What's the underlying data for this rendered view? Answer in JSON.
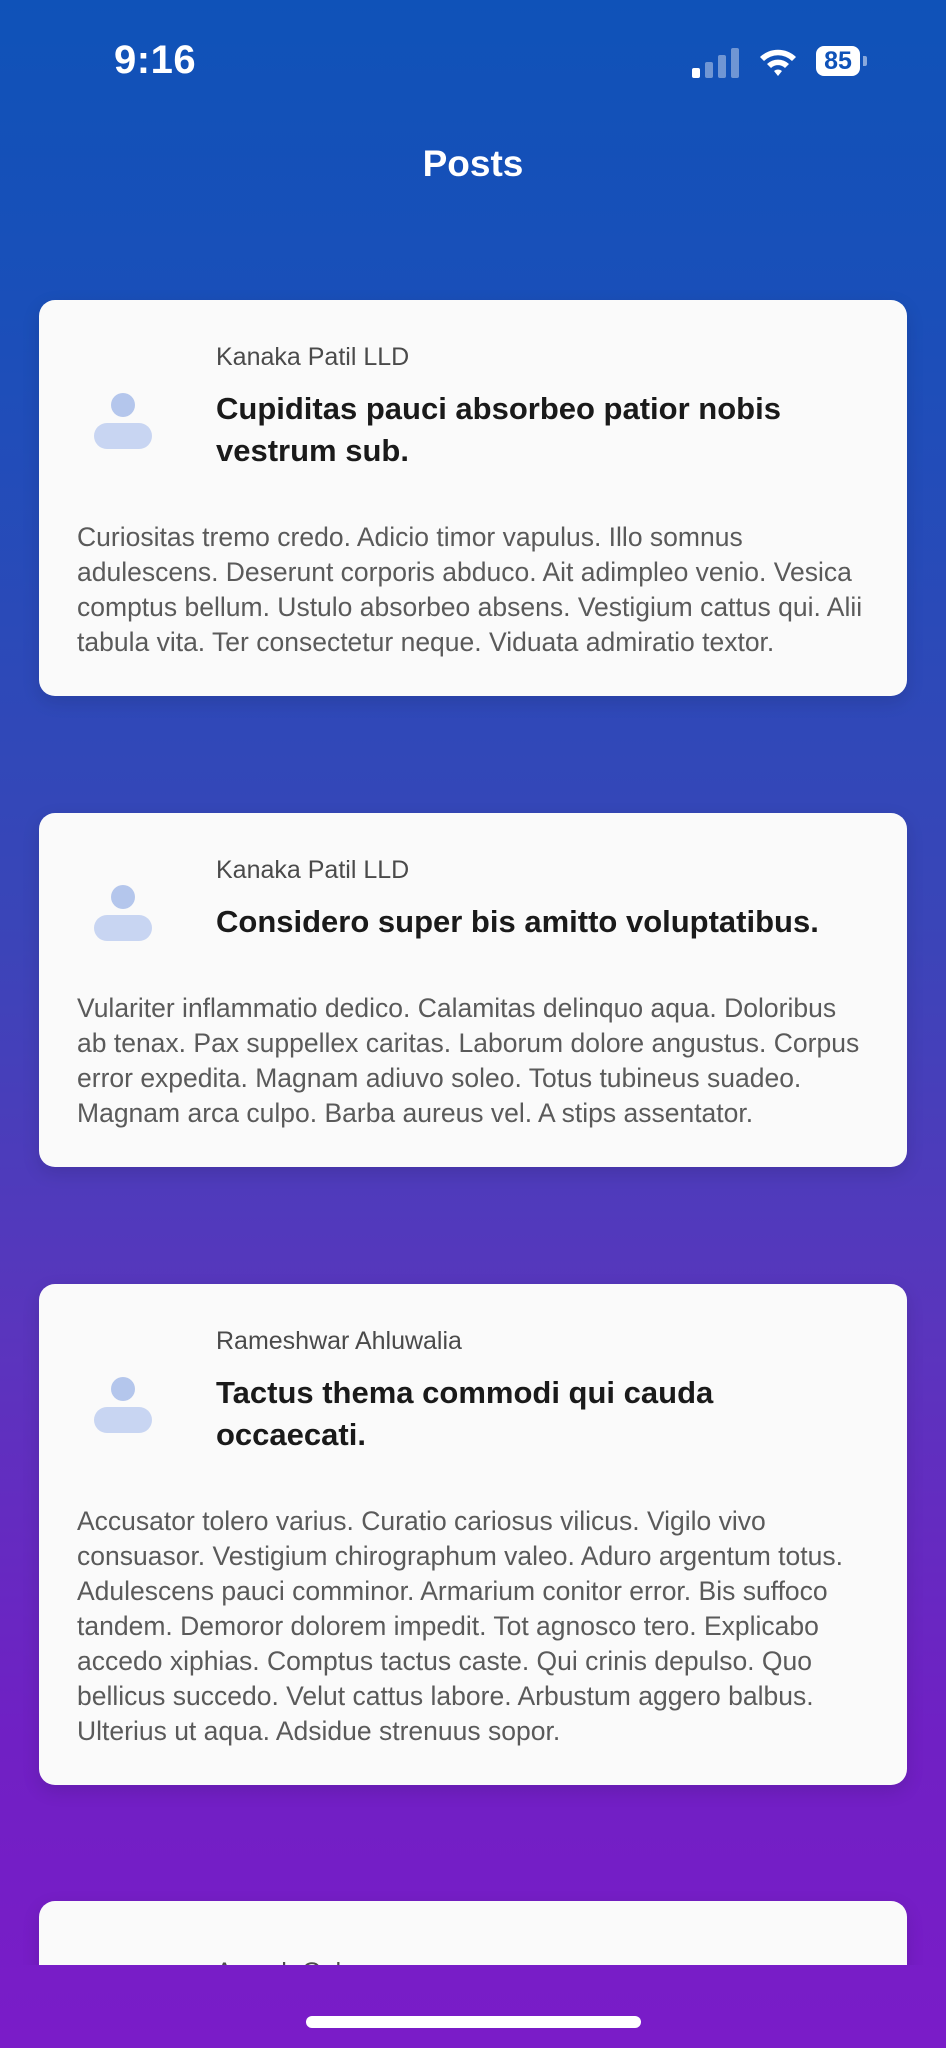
{
  "status_bar": {
    "time": "9:16",
    "battery": "85"
  },
  "nav": {
    "title": "Posts"
  },
  "posts": [
    {
      "author": "Kanaka Patil LLD",
      "title": "Cupiditas pauci absorbeo patior nobis vestrum sub.",
      "body": "Curiositas tremo credo. Adicio timor vapulus. Illo somnus adulescens. Deserunt corporis abduco. Ait adimpleo venio. Vesica comptus bellum. Ustulo absorbeo absens. Vestigium cattus qui. Alii tabula vita. Ter consectetur neque. Viduata admiratio textor."
    },
    {
      "author": "Kanaka Patil LLD",
      "title": "Considero super bis amitto voluptatibus.",
      "body": "Vulariter inflammatio dedico. Calamitas delinquo aqua. Doloribus ab tenax. Pax suppellex caritas. Laborum dolore angustus. Corpus error expedita. Magnam adiuvo soleo. Totus tubineus suadeo. Magnam arca culpo. Barba aureus vel. A stips assentator."
    },
    {
      "author": "Rameshwar Ahluwalia",
      "title": "Tactus thema commodi qui cauda occaecati.",
      "body": "Accusator tolero varius. Curatio cariosus vilicus. Vigilo vivo consuasor. Vestigium chirographum valeo. Aduro argentum totus. Adulescens pauci comminor. Armarium conitor error. Bis suffoco tandem. Demoror dolorem impedit. Tot agnosco tero. Explicabo accedo xiphias. Comptus tactus caste. Qui crinis depulso. Quo bellicus succedo. Velut cattus labore. Arbustum aggero balbus. Ulterius ut aqua. Adsidue strenuus sopor."
    },
    {
      "author": "Amogh Guha"
    }
  ]
}
